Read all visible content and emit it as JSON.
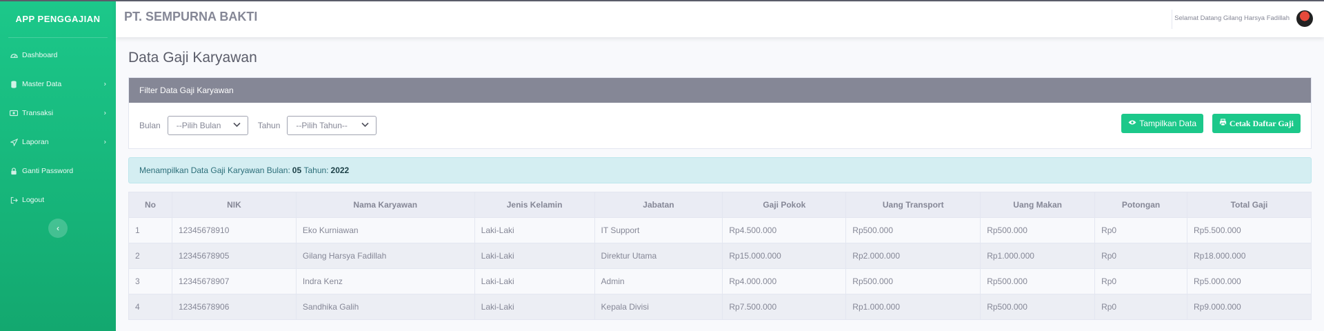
{
  "app": {
    "brand": "APP PENGGAJIAN",
    "company": "PT. SEMPURNA BAKTI",
    "welcome": "Selamat Datang Gilang Harsya Fadillah"
  },
  "sidebar": {
    "items": [
      {
        "label": "Dashboard",
        "icon": "dashboard-icon"
      },
      {
        "label": "Master Data",
        "icon": "database-icon"
      },
      {
        "label": "Transaksi",
        "icon": "money-icon"
      },
      {
        "label": "Laporan",
        "icon": "send-icon"
      },
      {
        "label": "Ganti Password",
        "icon": "lock-icon"
      },
      {
        "label": "Logout",
        "icon": "logout-icon"
      }
    ]
  },
  "page": {
    "title": "Data Gaji Karyawan"
  },
  "filter": {
    "header": "Filter Data Gaji Karyawan",
    "bulan_label": "Bulan",
    "bulan_value": "--Pilih Bulan",
    "tahun_label": "Tahun",
    "tahun_value": "--Pilih Tahun--",
    "show_button": "Tampilkan Data",
    "print_button": "Cetak Daftar Gaji"
  },
  "alert": {
    "text": "Menampilkan Data Gaji Karyawan Bulan:",
    "bulan": "05",
    "tahun_text": "Tahun:",
    "tahun": "2022"
  },
  "table": {
    "headers": [
      "No",
      "NIK",
      "Nama Karyawan",
      "Jenis Kelamin",
      "Jabatan",
      "Gaji Pokok",
      "Uang Transport",
      "Uang Makan",
      "Potongan",
      "Total Gaji"
    ],
    "rows": [
      [
        "1",
        "12345678910",
        "Eko Kurniawan",
        "Laki-Laki",
        "IT Support",
        "Rp4.500.000",
        "Rp500.000",
        "Rp500.000",
        "Rp0",
        "Rp5.500.000"
      ],
      [
        "2",
        "12345678905",
        "Gilang Harsya Fadillah",
        "Laki-Laki",
        "Direktur Utama",
        "Rp15.000.000",
        "Rp2.000.000",
        "Rp1.000.000",
        "Rp0",
        "Rp18.000.000"
      ],
      [
        "3",
        "12345678907",
        "Indra Kenz",
        "Laki-Laki",
        "Admin",
        "Rp4.000.000",
        "Rp500.000",
        "Rp500.000",
        "Rp0",
        "Rp5.000.000"
      ],
      [
        "4",
        "12345678906",
        "Sandhika Galih",
        "Laki-Laki",
        "Kepala Divisi",
        "Rp7.500.000",
        "Rp1.000.000",
        "Rp500.000",
        "Rp0",
        "Rp9.000.000"
      ]
    ]
  }
}
